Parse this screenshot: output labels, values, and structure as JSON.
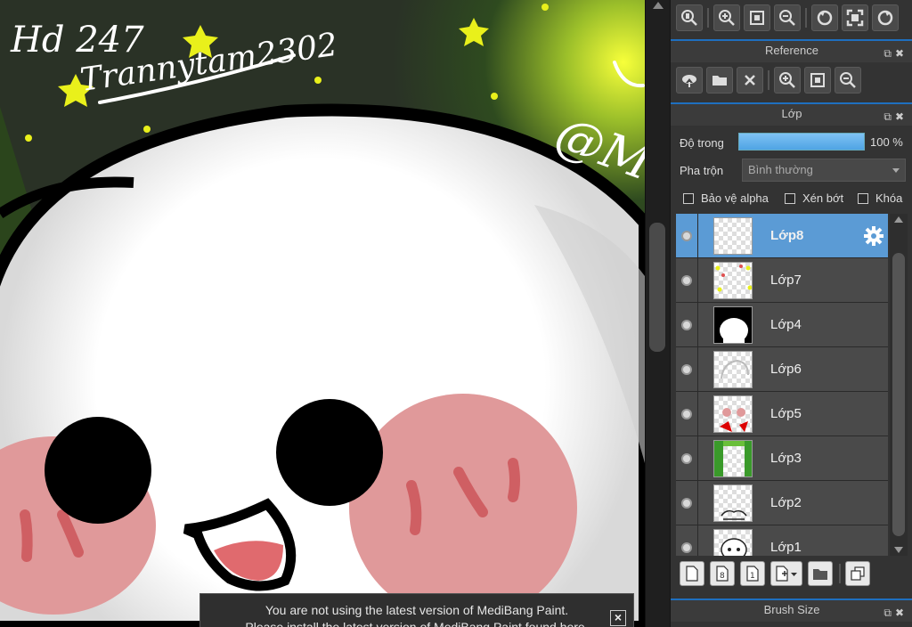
{
  "canvas": {
    "drawing_text_1": "Hd 247",
    "drawing_text_2": "Trannytam2302",
    "drawing_text_3": "@M"
  },
  "notice": {
    "line1": "You are not using the latest version of MediBang Paint.",
    "line2": "Please install the latest version of MediBang Paint found here.",
    "close_icon": "close-icon"
  },
  "top_toolbar": {
    "icons": [
      "zoom-actual-icon",
      "zoom-in-icon",
      "fit-window-icon",
      "zoom-out-icon",
      "rotate-left-icon",
      "fullscreen-icon",
      "rotate-right-icon"
    ]
  },
  "reference_panel": {
    "title": "Reference",
    "icons": [
      "upload-icon",
      "open-folder-icon",
      "close-icon",
      "zoom-in-icon",
      "fit-window-icon",
      "zoom-out-icon"
    ]
  },
  "layer_panel": {
    "title": "Lớp",
    "opacity_label": "Độ trong",
    "opacity_value": "100 %",
    "opacity_fraction": 1.0,
    "blend_label": "Pha trộn",
    "blend_value": "Bình thường",
    "protect_alpha": "Bảo vệ alpha",
    "clipping": "Xén bớt",
    "lock": "Khóa",
    "layers": [
      {
        "name": "Lớp8",
        "selected": true
      },
      {
        "name": "Lớp7",
        "selected": false
      },
      {
        "name": "Lớp4",
        "selected": false
      },
      {
        "name": "Lớp6",
        "selected": false
      },
      {
        "name": "Lớp5",
        "selected": false
      },
      {
        "name": "Lớp3",
        "selected": false
      },
      {
        "name": "Lớp2",
        "selected": false
      },
      {
        "name": "Lớp1",
        "selected": false
      }
    ],
    "tools": [
      "new-layer-icon",
      "new-halftone-layer-icon",
      "new-8bit-layer-icon",
      "add-layer-menu-icon",
      "new-folder-icon",
      "duplicate-layer-icon"
    ]
  },
  "brush_panel": {
    "title": "Brush Size"
  },
  "colors": {
    "accent": "#5b9bd5",
    "panel_bg": "#333333",
    "cheek_pink": "#e0999a",
    "star_yellow": "#e9f01b"
  }
}
